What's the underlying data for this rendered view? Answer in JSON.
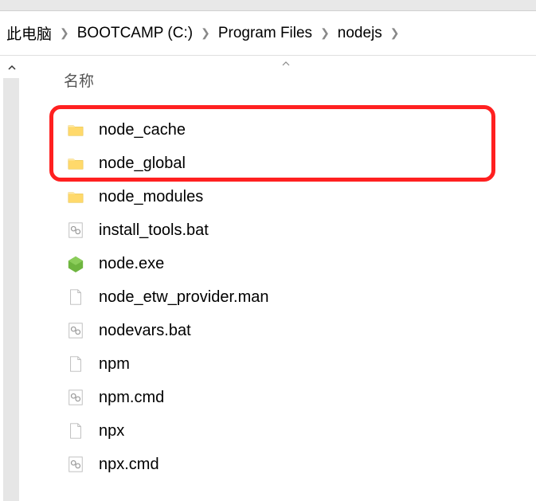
{
  "breadcrumb": {
    "items": [
      {
        "label": "此电脑"
      },
      {
        "label": "BOOTCAMP (C:)"
      },
      {
        "label": "Program Files"
      },
      {
        "label": "nodejs"
      }
    ]
  },
  "columns": {
    "name": "名称"
  },
  "files": [
    {
      "name": "node_cache",
      "type": "folder"
    },
    {
      "name": "node_global",
      "type": "folder"
    },
    {
      "name": "node_modules",
      "type": "folder"
    },
    {
      "name": "install_tools.bat",
      "type": "bat"
    },
    {
      "name": "node.exe",
      "type": "exe"
    },
    {
      "name": "node_etw_provider.man",
      "type": "file"
    },
    {
      "name": "nodevars.bat",
      "type": "bat"
    },
    {
      "name": "npm",
      "type": "file"
    },
    {
      "name": "npm.cmd",
      "type": "bat"
    },
    {
      "name": "npx",
      "type": "file"
    },
    {
      "name": "npx.cmd",
      "type": "bat"
    }
  ]
}
